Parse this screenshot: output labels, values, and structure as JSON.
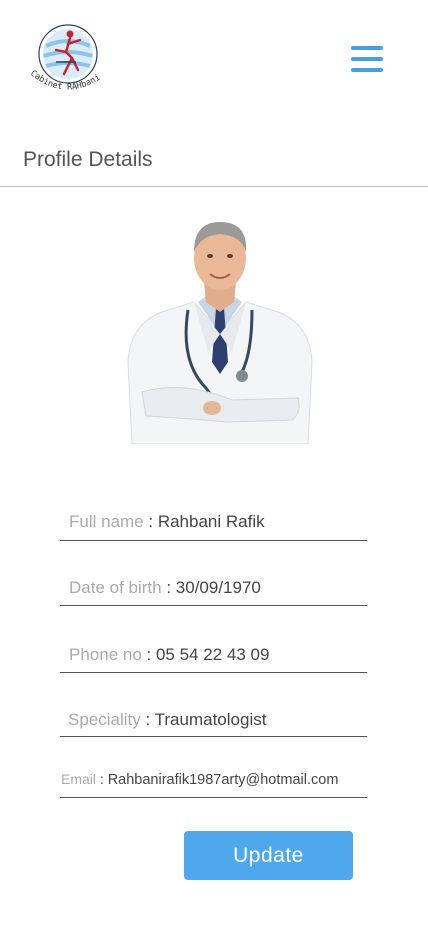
{
  "header": {
    "logo_text": "Cabinet RAHbani",
    "menu_icon": "hamburger-menu-icon"
  },
  "page": {
    "title": "Profile Details"
  },
  "profile": {
    "photo_icon": "doctor-photo",
    "fields": {
      "full_name": {
        "label": "Full name",
        "sep": " : ",
        "value": "Rahbani Rafik"
      },
      "dob": {
        "label": "Date of birth",
        "sep": " : ",
        "value": "30/09/1970"
      },
      "phone": {
        "label": "Phone no",
        "sep": " : ",
        "value": "05 54 22 43 09"
      },
      "speciality": {
        "label": "Speciality",
        "sep": " : ",
        "value": "Traumatologist"
      },
      "email": {
        "label": "Email",
        "sep": " : ",
        "value": "Rahbanirafik1987arty@hotmail.com"
      }
    }
  },
  "actions": {
    "update_label": "Update"
  },
  "colors": {
    "accent": "#4a9de0",
    "button": "#4fa8ec",
    "label": "#aaaaaa",
    "value": "#444444",
    "logo_red": "#c8202f"
  }
}
